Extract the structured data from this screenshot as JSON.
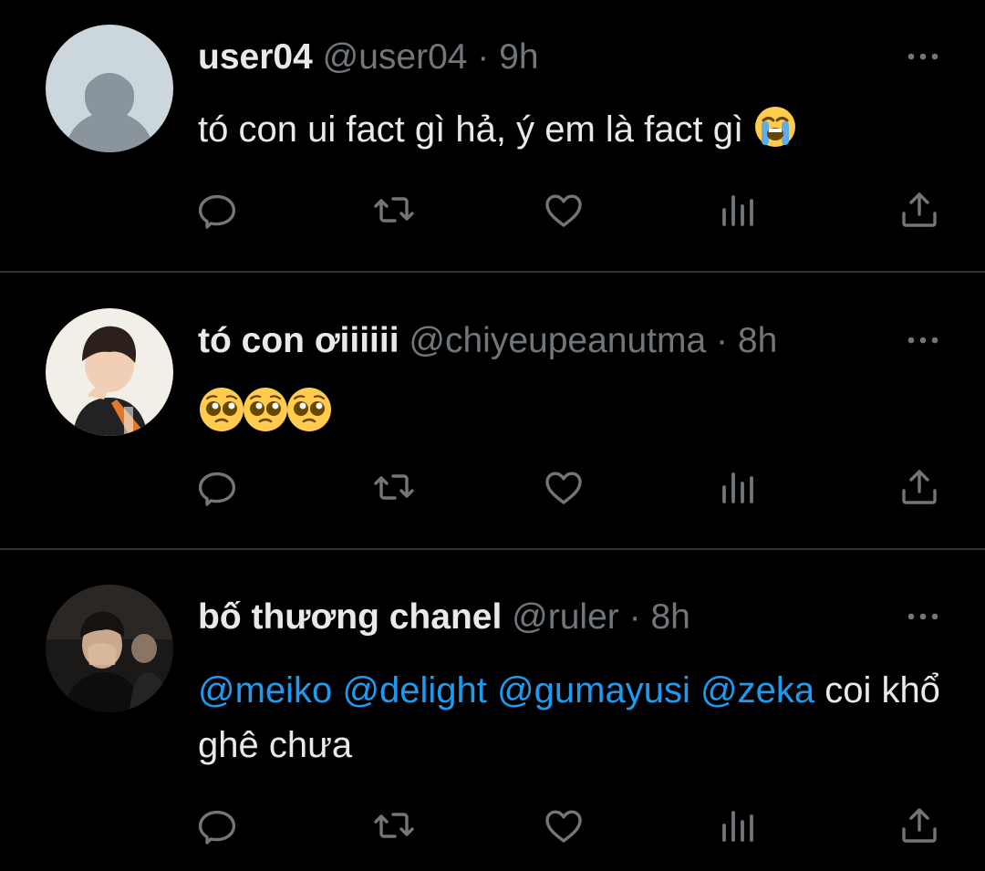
{
  "colors": {
    "background": "#000000",
    "text_primary": "#e7e9ea",
    "text_secondary": "#71767b",
    "mention": "#1d9bf0",
    "divider": "#2f3336"
  },
  "tweets": [
    {
      "display_name": "user04",
      "handle": "@user04",
      "separator": "·",
      "time": "9h",
      "text": "tó con ui fact gì hả, ý em là fact gì",
      "emoji": "loudly-crying-face",
      "avatar": "default-profile-avatar"
    },
    {
      "display_name": "tó con ơiiiiii",
      "handle": "@chiyeupeanutma",
      "separator": "·",
      "time": "8h",
      "emoji": [
        "pleading-face",
        "pleading-face",
        "pleading-face"
      ],
      "avatar": "profile-photo"
    },
    {
      "display_name": "bố thương chanel",
      "handle": "@ruler",
      "separator": "·",
      "time": "8h",
      "mentions": [
        "@meiko",
        "@delight",
        "@gumayusi",
        "@zeka"
      ],
      "text_after_mentions": " coi khổ ghê chưa",
      "avatar": "profile-photo"
    }
  ],
  "action_icons": [
    "reply-icon",
    "retweet-icon",
    "like-icon",
    "views-icon",
    "share-icon"
  ]
}
